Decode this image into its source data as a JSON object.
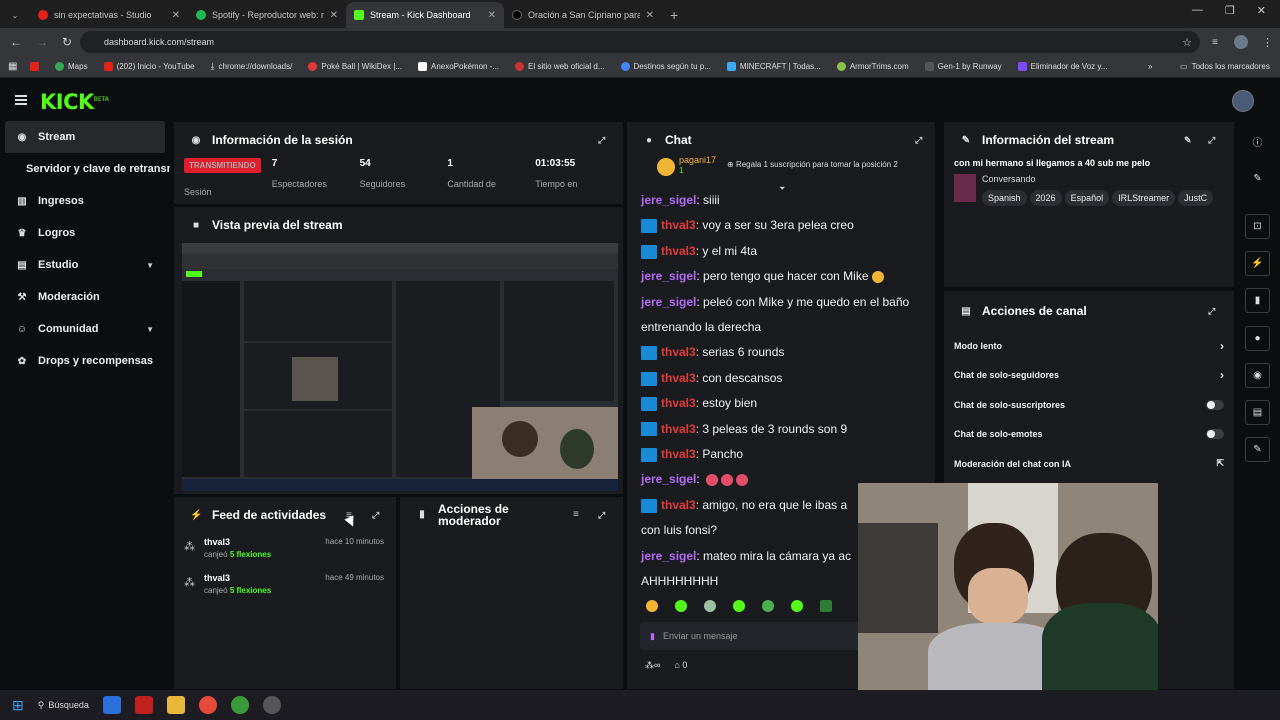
{
  "browser": {
    "tabs": [
      {
        "label": "sin expectativas - Studio",
        "color": "#e62117"
      },
      {
        "label": "Spotify - Reproductor web: mú",
        "color": "#1db954"
      },
      {
        "label": "Stream - Kick Dashboard",
        "color": "#53fc18"
      },
      {
        "label": "Oración a San Cipriano para At",
        "color": "#222222"
      }
    ],
    "url": "dashboard.kick.com/stream",
    "bookmarks": [
      "Maps",
      "(202) Inicio - YouTube",
      "chrome://downloads/",
      "Poké Ball | WikiDex |...",
      "AnexoPokémon -...",
      "El sitio web oficial d...",
      "Destinos según tu p...",
      "MINECRAFT | Todas...",
      "ArmorTrims.com",
      "Gen-1 by Runway",
      "Eliminador de Voz y..."
    ],
    "bookmarks_all": "Todos los marcadores"
  },
  "kick": {
    "logo": "KICK",
    "logo_sup": "BETA",
    "sidebar": [
      {
        "label": "Stream",
        "icon": "broadcast-icon"
      },
      {
        "label": "Servidor y clave de retransmisión",
        "icon": ""
      },
      {
        "label": "Ingresos",
        "icon": "bars-icon"
      },
      {
        "label": "Logros",
        "icon": "trophy-icon"
      },
      {
        "label": "Estudio",
        "icon": "studio-icon"
      },
      {
        "label": "Moderación",
        "icon": "hammer-icon"
      },
      {
        "label": "Comunidad",
        "icon": "people-icon"
      },
      {
        "label": "Drops y recompensas",
        "icon": "gift-icon"
      }
    ],
    "session": {
      "title": "Información de la sesión",
      "live_label": "TRANSMITIENDO",
      "session_label": "Sesión",
      "stats": [
        {
          "value": "7",
          "label": "Espectadores"
        },
        {
          "value": "54",
          "label": "Seguidores"
        },
        {
          "value": "1",
          "label": "Cantidad de"
        },
        {
          "value": "01:03:55",
          "label": "Tiempo en"
        }
      ]
    },
    "preview": {
      "title": "Vista previa del stream"
    },
    "feed": {
      "title": "Feed de actividades",
      "items": [
        {
          "user": "thval3",
          "time": "hace 10 minutos",
          "action": "canjeó",
          "reward": "5 flexiones"
        },
        {
          "user": "thval3",
          "time": "hace 49 minutos",
          "action": "canjeó",
          "reward": "5 flexiones"
        }
      ]
    },
    "mod_actions": {
      "title_line1": "Acciones de",
      "title_line2": "moderador"
    },
    "chat": {
      "title": "Chat",
      "pinned_user": "pagani17",
      "pinned_count": "1",
      "gift_prompt": "Regala 1 suscripción para tomar la posición 2",
      "messages": [
        {
          "user": "jere_sigel",
          "text": "siiii",
          "badge": false,
          "emotes": 0
        },
        {
          "user": "thval3",
          "text": "voy a ser su 3era pelea creo",
          "badge": true,
          "emotes": 0
        },
        {
          "user": "thval3",
          "text": "y el mi 4ta",
          "badge": true,
          "emotes": 0
        },
        {
          "user": "jere_sigel",
          "text": "pero tengo que hacer con Mike",
          "badge": false,
          "emotes": 1
        },
        {
          "user": "jere_sigel",
          "text": "peleó con Mike y me quedo en el baño",
          "badge": false,
          "emotes": 0
        },
        {
          "user": "",
          "text": "entrenando la derecha",
          "badge": false,
          "emotes": 0
        },
        {
          "user": "thval3",
          "text": "serias 6 rounds",
          "badge": true,
          "emotes": 0
        },
        {
          "user": "thval3",
          "text": "con descansos",
          "badge": true,
          "emotes": 0
        },
        {
          "user": "thval3",
          "text": "estoy bien",
          "badge": true,
          "emotes": 0
        },
        {
          "user": "thval3",
          "text": "3 peleas de 3 rounds son 9",
          "badge": true,
          "emotes": 0
        },
        {
          "user": "thval3",
          "text": "Pancho",
          "badge": true,
          "emotes": 0
        },
        {
          "user": "jere_sigel",
          "text": "",
          "badge": false,
          "emotes": 3
        },
        {
          "user": "thval3",
          "text": "amigo, no era que le ibas a",
          "badge": true,
          "emotes": 0
        },
        {
          "user": "",
          "text": "con luis fonsi?",
          "badge": false,
          "emotes": 0
        },
        {
          "user": "jere_sigel",
          "text": "mateo mira la cámara ya ac",
          "badge": false,
          "emotes": 0
        },
        {
          "user": "",
          "text": "AHHHHHHHH",
          "badge": false,
          "emotes": 0
        }
      ],
      "input_placeholder": "Enviar un mensaje",
      "points": "0"
    },
    "stream_info": {
      "title": "Información del stream",
      "stream_title": "con mi hermano si llegamos a 40 sub me pelo",
      "category": "Conversando",
      "tags": [
        "Spanish",
        "2026",
        "Español",
        "IRLStreamer",
        "JustC"
      ]
    },
    "channel_actions": {
      "title": "Acciones de canal",
      "rows": [
        {
          "label": "Modo lento",
          "control": "chevron"
        },
        {
          "label": "Chat de solo-seguidores",
          "control": "chevron"
        },
        {
          "label": "Chat de solo-suscriptores",
          "control": "toggle"
        },
        {
          "label": "Chat de solo-emotes",
          "control": "toggle"
        },
        {
          "label": "Moderación del chat con IA",
          "control": "external"
        }
      ]
    },
    "colors": {
      "accent": "#53fc18",
      "live": "#e11d2e",
      "panel": "#191b1f"
    }
  },
  "taskbar": {
    "search": "Búsqueda"
  }
}
